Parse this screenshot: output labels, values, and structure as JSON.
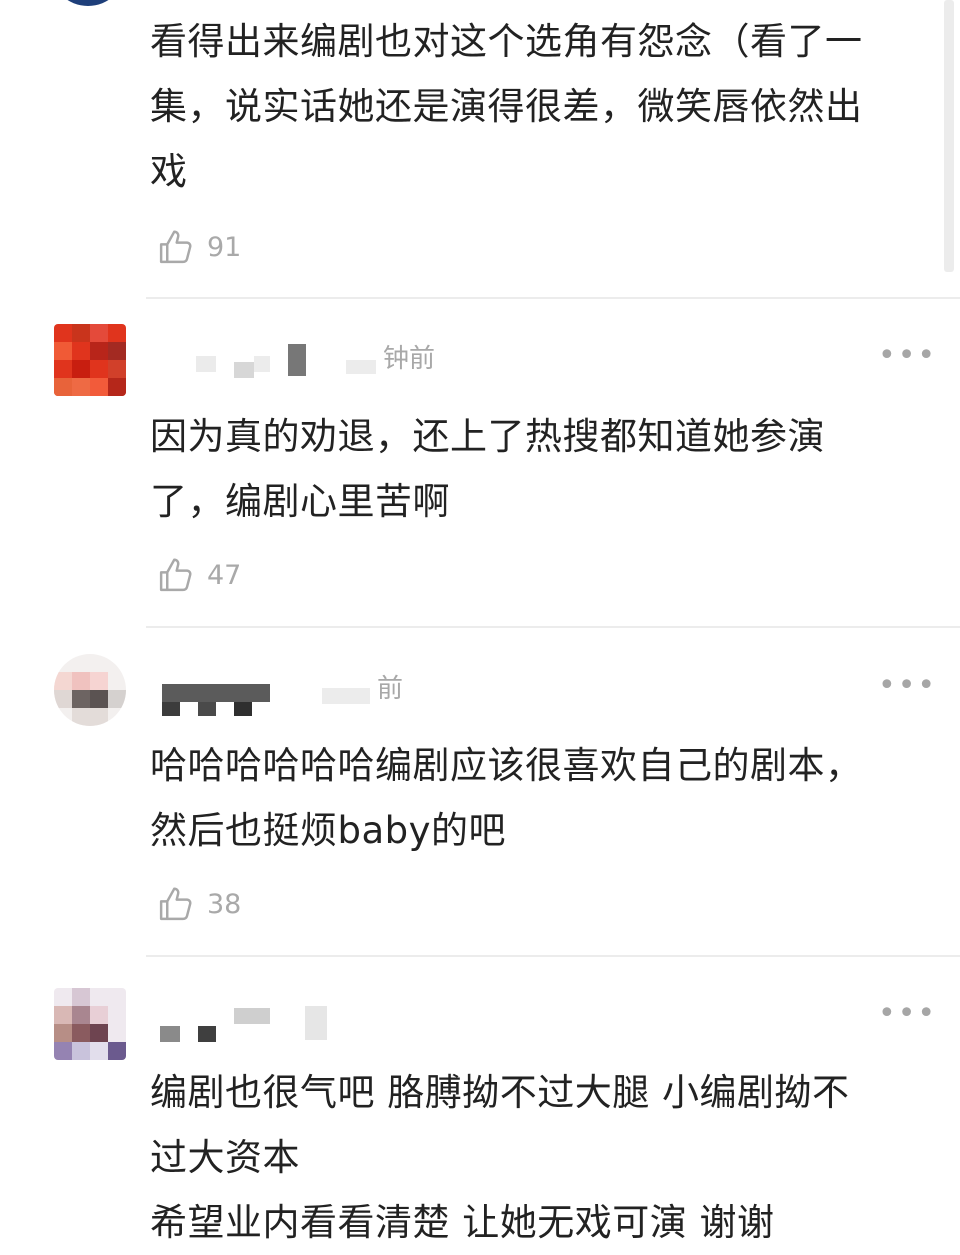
{
  "comments": [
    {
      "lines": [
        "看得出来编剧也对这个选角有怨念（看了一",
        "集，说实话她还是演得很差，微笑唇依然出",
        "戏"
      ],
      "likes": "91"
    },
    {
      "time_suffix": "钟前",
      "lines": [
        "因为真的劝退，还上了热搜都知道她参演",
        "了，编剧心里苦啊"
      ],
      "likes": "47",
      "more_label": "•••"
    },
    {
      "time_suffix": "前",
      "lines": [
        "哈哈哈哈哈哈编剧应该很喜欢自己的剧本，",
        "然后也挺烦baby的吧"
      ],
      "likes": "38",
      "more_label": "•••"
    },
    {
      "lines": [
        "编剧也很气吧 胳膊拗不过大腿 小编剧拗不",
        "过大资本",
        "希望业内看看清楚 让她无戏可演 谢谢"
      ],
      "more_label": "•••"
    }
  ],
  "icons": {
    "like": "thumbs-up-icon",
    "more": "more-dots-icon"
  },
  "colors": {
    "text": "#222222",
    "meta": "#a9a9a9",
    "divider": "#ececec",
    "background": "#ffffff"
  }
}
